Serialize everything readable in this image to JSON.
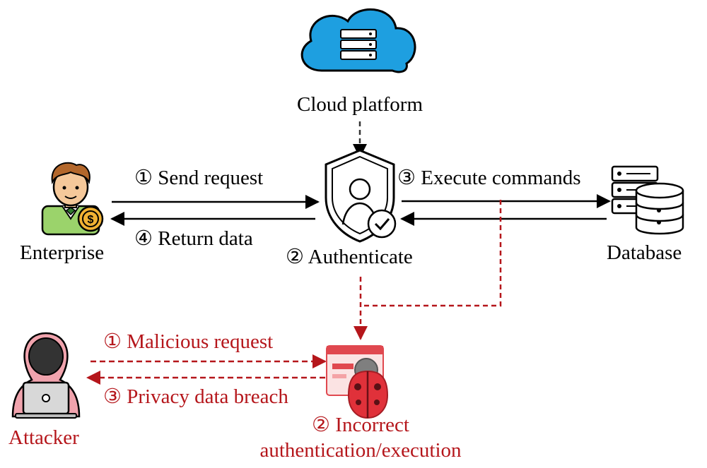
{
  "colors": {
    "normal": "#000000",
    "attack": "#b5161b",
    "cloud": "#1e9fe0",
    "pink": "#f0a3ad",
    "dark": "#333333"
  },
  "nodes": {
    "cloud": {
      "label": "Cloud platform",
      "icon": "cloud-server-icon"
    },
    "enterprise": {
      "label": "Enterprise",
      "icon": "businessman-icon"
    },
    "authenticate": {
      "label": "② Authenticate",
      "icon": "shield-user-check-icon"
    },
    "database": {
      "label": "Database",
      "icon": "database-server-icon"
    },
    "attacker": {
      "label": "Attacker",
      "icon": "hooded-hacker-icon"
    },
    "vulnerability": {
      "label_line1": "② Incorrect",
      "label_line2": "authentication/execution",
      "icon": "ladybug-bug-icon"
    }
  },
  "edges": {
    "send_request": "① Send request",
    "return_data": "④ Return data",
    "execute_commands": "③ Execute commands",
    "malicious_request": "① Malicious request",
    "privacy_breach": "③ Privacy data breach"
  }
}
